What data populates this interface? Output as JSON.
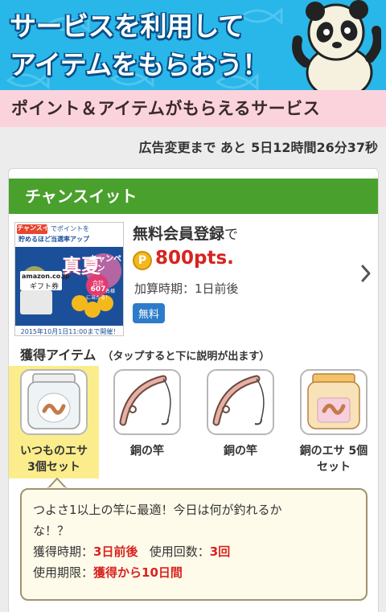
{
  "banner": {
    "line1": "サービスを利用して",
    "line2": "アイテムをもらおう！"
  },
  "strip": {
    "title": "ポイント＆アイテムがもらえるサービス"
  },
  "countdown": {
    "label": "広告変更まで あと",
    "value": "5日12時間26分37秒"
  },
  "card": {
    "header": "チャンスイット",
    "offer": {
      "title": "無料会員登録",
      "title_suffix": "で",
      "coin_glyph": "P",
      "points": "800pts.",
      "timing": "加算時期：1日前後",
      "badge": "無料",
      "thumb": {
        "brand": "チャンスイット",
        "top_text": "でポイントを",
        "sub_text": "貯めるほど当選率アップ",
        "headline_1": "真夏",
        "headline_2": "キャンペーン",
        "amazon": "amazon.co.jp",
        "gift": "ギフト券",
        "total_label": "合計",
        "total_value": "607",
        "total_unit": "名様",
        "total_tail": "に当たる！",
        "deadline": "2015年10月1日11:00まで開催！"
      }
    },
    "items_heading": "獲得アイテム",
    "items_note": "（タップすると下に説明が出ます）",
    "items": [
      {
        "label": "いつものエサ3個セット",
        "line1": "いつものエサ",
        "line2": "3個セット",
        "icon": "worm-jar-icon",
        "selected": true
      },
      {
        "label": "銅の竿",
        "line1": "銅の竿",
        "line2": "",
        "icon": "fishing-rod-icon",
        "selected": false
      },
      {
        "label": "銅の竿",
        "line1": "銅の竿",
        "line2": "",
        "icon": "fishing-rod-icon",
        "selected": false
      },
      {
        "label": "銅のエサ 5個セット",
        "line1": "銅のエサ 5個",
        "line2": "セット",
        "icon": "worm-jar-icon",
        "selected": false
      }
    ],
    "description": {
      "text_1": "つよさ1以上の竿に最適！今日は何が釣れるか",
      "text_2": "な！？",
      "acquire_label": "獲得時期：",
      "acquire_value": "3日前後",
      "uses_label": "使用回数：",
      "uses_value": "3回",
      "expiry_label": "使用期限：",
      "expiry_value": "獲得から10日間"
    }
  },
  "colors": {
    "banner": "#29b6e8",
    "strip": "#fbd3dd",
    "header": "#4aa02c",
    "points": "#d8231f",
    "badge": "#2d7cc9",
    "selected": "#fbed8c"
  }
}
